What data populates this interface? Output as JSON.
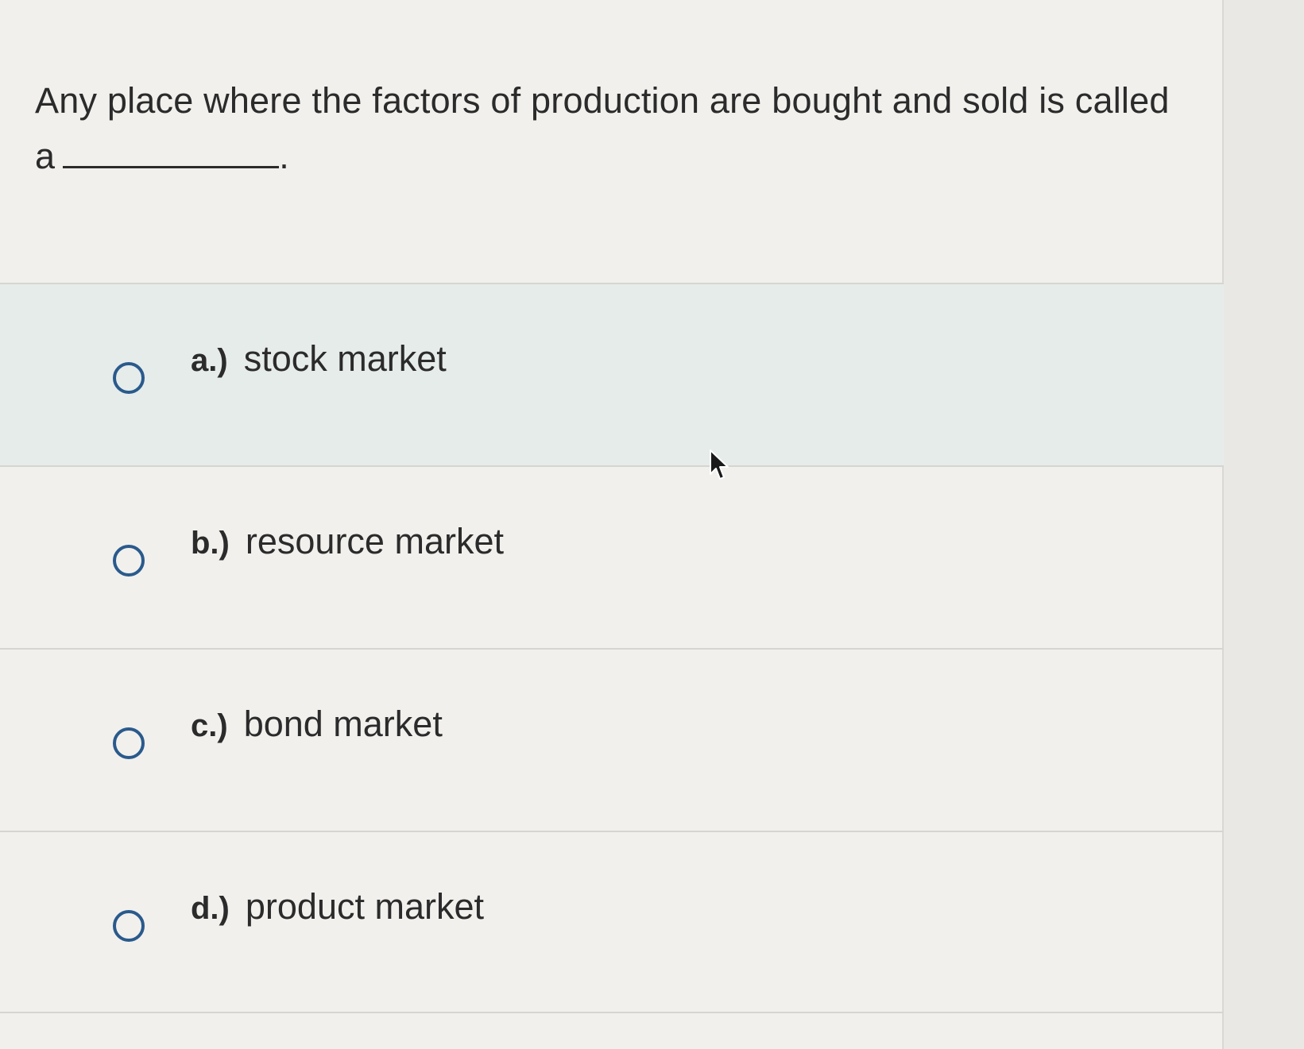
{
  "question": {
    "text": "Any place where the factors of production are bought and sold is called a",
    "end_punct": "."
  },
  "options": [
    {
      "letter": "a.)",
      "label": "stock market",
      "hovered": true
    },
    {
      "letter": "b.)",
      "label": "resource market",
      "hovered": false
    },
    {
      "letter": "c.)",
      "label": "bond market",
      "hovered": false
    },
    {
      "letter": "d.)",
      "label": "product market",
      "hovered": false
    }
  ],
  "colors": {
    "radio_border": "#2a5a8c",
    "hover_background": "#e6ecea",
    "text": "#2b2b2b"
  },
  "icons": {
    "radio": "radio-empty-icon",
    "cursor": "mouse-pointer-icon"
  }
}
